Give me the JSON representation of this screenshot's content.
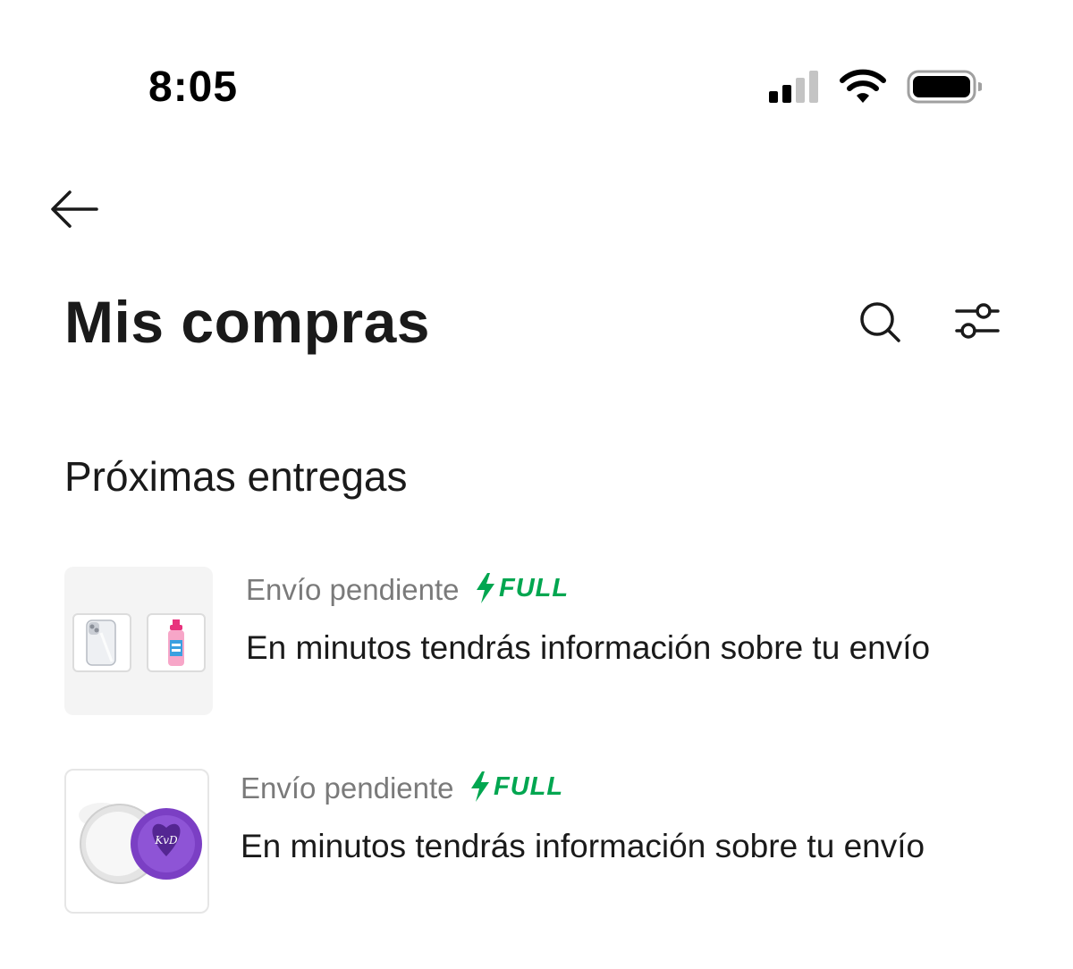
{
  "status_bar": {
    "time": "8:05"
  },
  "header": {
    "title": "Mis compras"
  },
  "section": {
    "title": "Próximas entregas"
  },
  "orders": [
    {
      "status": "Envío pendiente",
      "badge": "FULL",
      "message": "En minutos tendrás información sobre tu envío"
    },
    {
      "status": "Envío pendiente",
      "badge": "FULL",
      "message": "En minutos tendrás información sobre tu envío"
    }
  ],
  "colors": {
    "full_green": "#00a650",
    "status_gray": "#7a7a7a",
    "text_dark": "#1a1a1a"
  },
  "icons": [
    "back-arrow-icon",
    "search-icon",
    "filter-icon",
    "bolt-icon",
    "signal-icon",
    "wifi-icon",
    "battery-icon"
  ]
}
